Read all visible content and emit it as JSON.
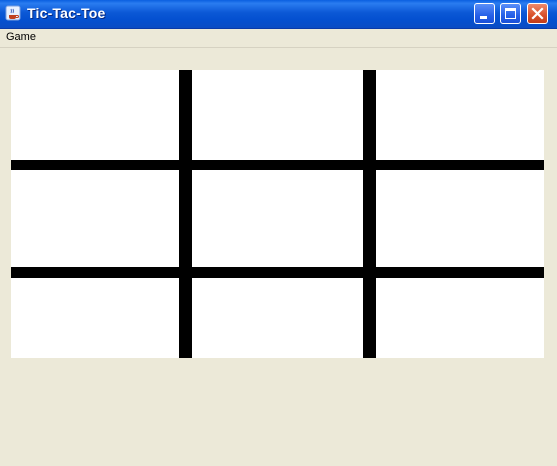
{
  "window": {
    "title": "Tic-Tac-Toe",
    "icon": "java-coffee-icon"
  },
  "window_controls": {
    "minimize_icon": "minimize-icon",
    "maximize_icon": "maximize-icon",
    "close_icon": "close-icon"
  },
  "menubar": {
    "items": [
      {
        "label": "Game"
      }
    ]
  },
  "board": {
    "rows": 3,
    "cols": 3,
    "cells": [
      [
        "",
        "",
        ""
      ],
      [
        "",
        "",
        ""
      ],
      [
        "",
        "",
        ""
      ]
    ],
    "background_color": "#ffffff",
    "line_color": "#000000"
  }
}
